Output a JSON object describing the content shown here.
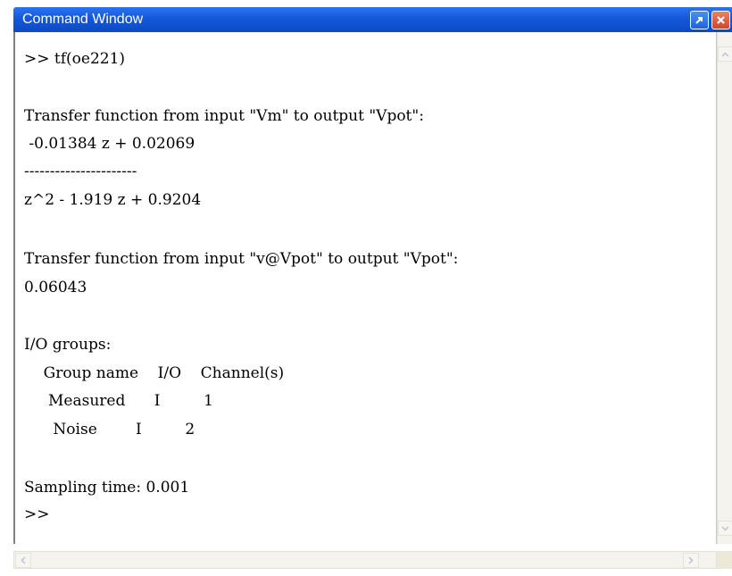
{
  "window": {
    "title": "Command Window",
    "undock_icon": "undock-arrow-icon",
    "close_icon": "close-x-icon"
  },
  "console": {
    "lines": [
      ">> tf(oe221)",
      "",
      "Transfer function from input \"Vm\" to output \"Vpot\":",
      " -0.01384 z + 0.02069",
      "----------------------",
      "z^2 - 1.919 z + 0.9204",
      "",
      "Transfer function from input \"v@Vpot\" to output \"Vpot\":",
      "0.06043",
      "",
      "I/O groups:",
      "    Group name    I/O    Channel(s)",
      "     Measured      I         1",
      "      Noise        I         2",
      "",
      "Sampling time: 0.001",
      ">>"
    ]
  },
  "scrollbars": {
    "up_icon": "scroll-up-arrow-icon",
    "down_icon": "scroll-down-arrow-icon",
    "left_icon": "scroll-left-arrow-icon",
    "right_icon": "scroll-right-arrow-icon"
  },
  "colors": {
    "titlebar": "#1458d8",
    "close_button": "#d2442a",
    "background": "#ffffff",
    "text": "#000000"
  }
}
